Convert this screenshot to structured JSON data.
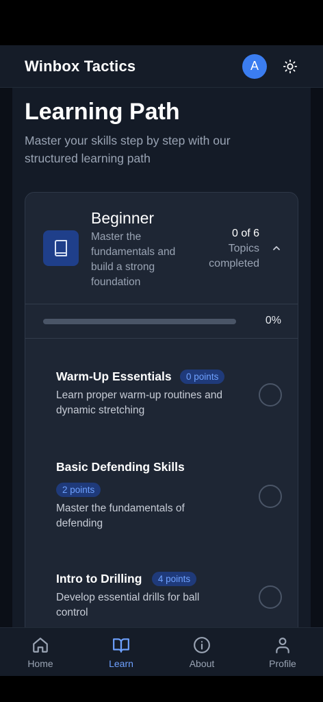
{
  "header": {
    "app_title": "Winbox Tactics",
    "avatar_initial": "A"
  },
  "page": {
    "title": "Learning Path",
    "subtitle": "Master your skills step by step with our structured learning path"
  },
  "level": {
    "name": "Beginner",
    "description": "Master the fundamentals and build a strong foundation",
    "completed_count": "0 of 6",
    "completed_label_1": "Topics",
    "completed_label_2": "completed",
    "progress_text": "0%",
    "progress_fraction": 0
  },
  "topics": [
    {
      "title": "Warm-Up Essentials",
      "points": "0 points",
      "description": "Learn proper warm-up routines and dynamic stretching",
      "completed": false
    },
    {
      "title": "Basic Defending Skills",
      "points": "2 points",
      "description": "Master the fundamentals of defending",
      "completed": false
    },
    {
      "title": "Intro to Drilling",
      "points": "4 points",
      "description": "Develop essential drills for ball control",
      "completed": false
    }
  ],
  "nav": [
    {
      "label": "Home",
      "icon": "home-icon",
      "active": false
    },
    {
      "label": "Learn",
      "icon": "book-icon",
      "active": true
    },
    {
      "label": "About",
      "icon": "info-icon",
      "active": false
    },
    {
      "label": "Profile",
      "icon": "user-icon",
      "active": false
    }
  ],
  "colors": {
    "accent": "#3b7df0",
    "accent_text": "#6ea1ff",
    "background": "#0b0f17",
    "card": "#1e2634"
  }
}
